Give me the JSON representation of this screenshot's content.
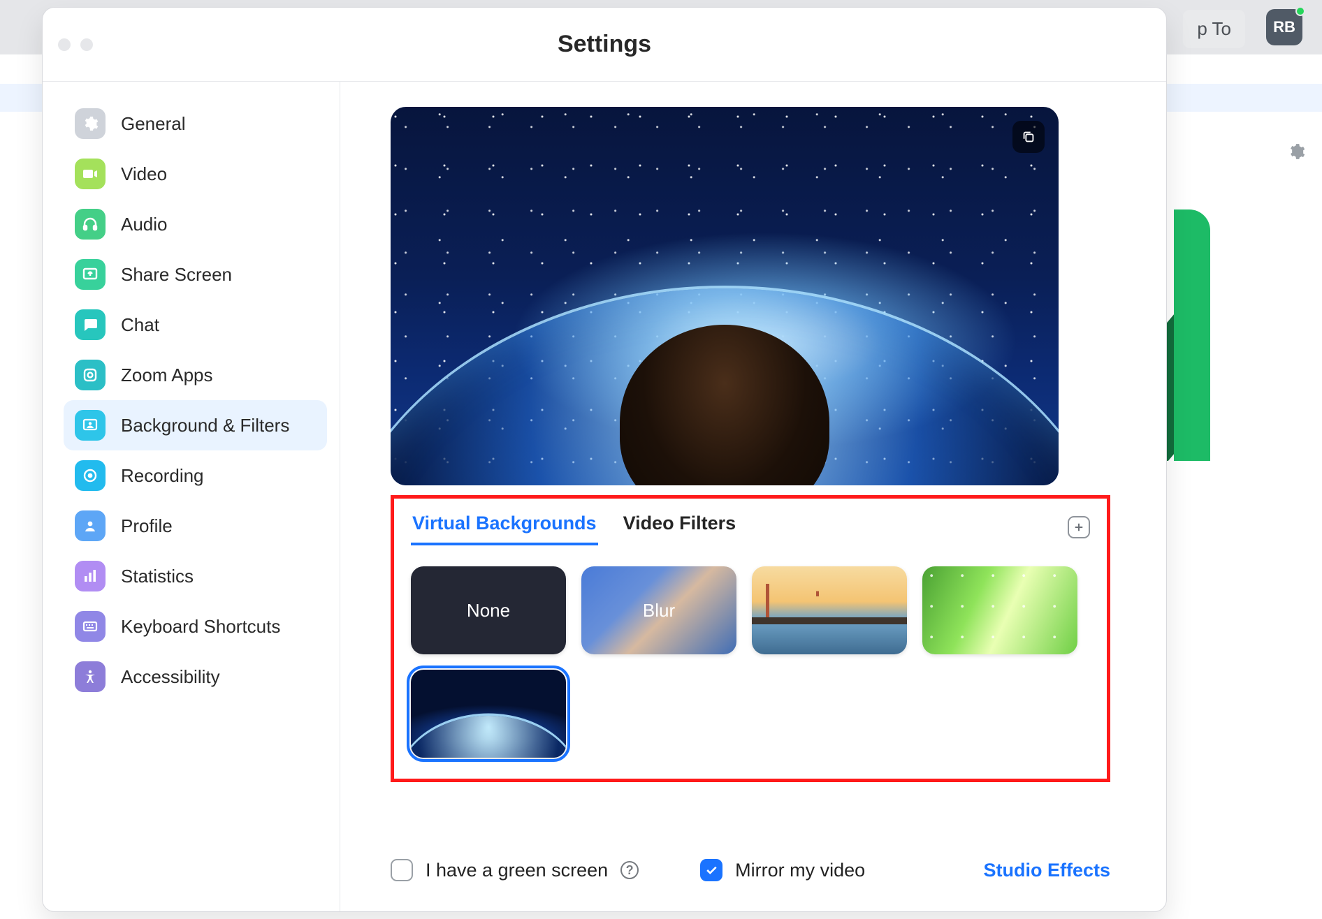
{
  "window": {
    "title": "Settings"
  },
  "bg": {
    "pill": "p To",
    "avatar": "RB"
  },
  "sidebar": {
    "items": [
      {
        "label": "General"
      },
      {
        "label": "Video"
      },
      {
        "label": "Audio"
      },
      {
        "label": "Share Screen"
      },
      {
        "label": "Chat"
      },
      {
        "label": "Zoom Apps"
      },
      {
        "label": "Background & Filters"
      },
      {
        "label": "Recording"
      },
      {
        "label": "Profile"
      },
      {
        "label": "Statistics"
      },
      {
        "label": "Keyboard Shortcuts"
      },
      {
        "label": "Accessibility"
      }
    ]
  },
  "tabs": {
    "virtual": "Virtual Backgrounds",
    "filters": "Video Filters"
  },
  "thumbs": {
    "none": "None",
    "blur": "Blur"
  },
  "footer": {
    "greenscreen": "I have a green screen",
    "mirror": "Mirror my video",
    "studio": "Studio Effects"
  }
}
